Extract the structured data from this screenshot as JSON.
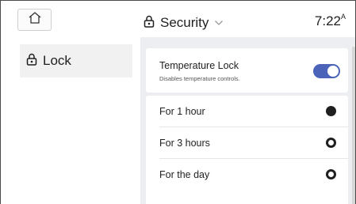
{
  "header": {
    "title": "Security",
    "time": "7:22",
    "time_suffix": "A"
  },
  "icons": {
    "home": "home-icon",
    "title_lock": "lock-icon",
    "dropdown": "chevron-down-icon",
    "sidebar_lock": "lock-icon"
  },
  "sidebar": {
    "items": [
      {
        "label": "Lock",
        "icon": "lock-icon",
        "selected": true
      }
    ]
  },
  "main": {
    "temperature_lock": {
      "title": "Temperature Lock",
      "subtitle": "Disables temperature controls.",
      "enabled": true
    },
    "options": [
      {
        "label": "For 1 hour",
        "selected": true
      },
      {
        "label": "For 3 hours",
        "selected": false
      },
      {
        "label": "For the day",
        "selected": false
      }
    ]
  },
  "colors": {
    "accent": "#4b63b8",
    "panel_bg": "#eceef1",
    "sidebar_selected_bg": "#f1f1f1"
  }
}
